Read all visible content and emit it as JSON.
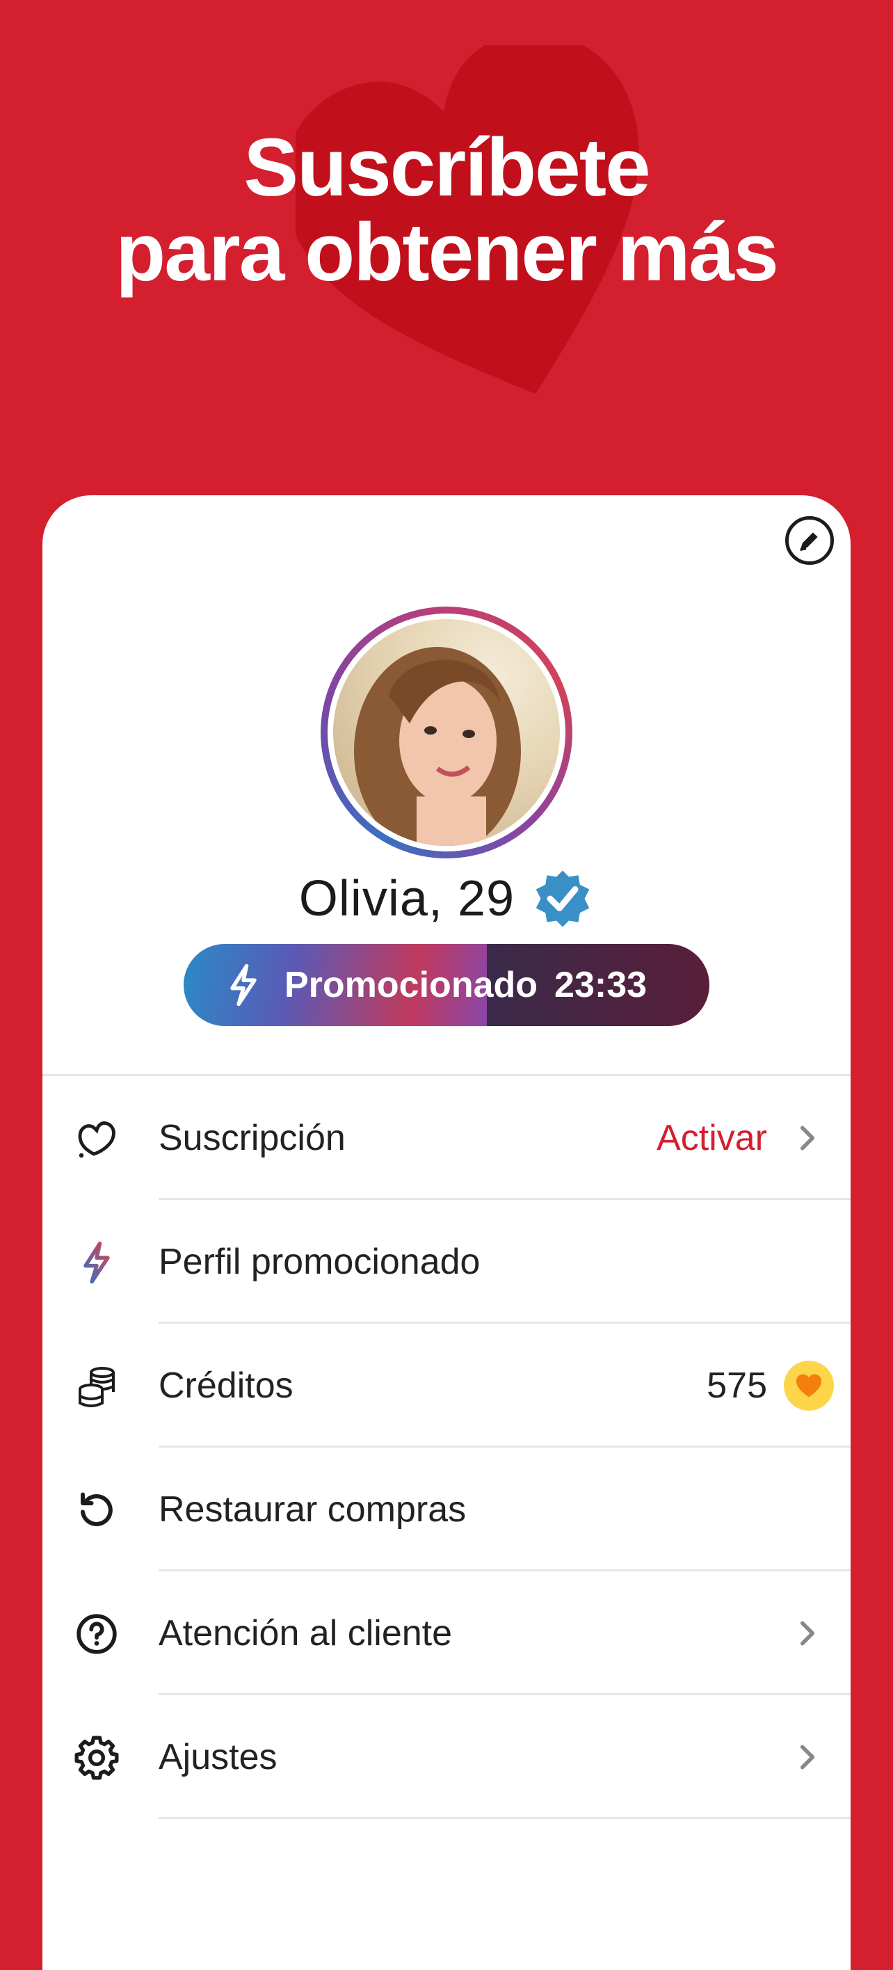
{
  "header": {
    "line1": "Suscríbete",
    "line2": "para obtener más"
  },
  "profile": {
    "name": "Olivia, 29",
    "verified": true,
    "promo_label": "Promocionado",
    "promo_timer": "23:33"
  },
  "menu": [
    {
      "label": "Suscripción",
      "value": "Activar",
      "icon": "heart-outline-icon",
      "chevron": true
    },
    {
      "label": "Perfil promocionado",
      "icon": "lightning-icon",
      "chevron": false
    },
    {
      "label": "Créditos",
      "value": "575",
      "icon": "coins-stack-icon",
      "chevron": false
    },
    {
      "label": "Restaurar compras",
      "icon": "restore-icon",
      "chevron": false
    },
    {
      "label": "Atención al cliente",
      "icon": "help-circle-icon",
      "chevron": true
    },
    {
      "label": "Ajustes",
      "icon": "gear-icon",
      "chevron": true
    }
  ],
  "colors": {
    "background": "#d41f2f",
    "accent_red": "#d41f2f",
    "coin": "#fdd54a",
    "verified": "#3a8fc6"
  }
}
